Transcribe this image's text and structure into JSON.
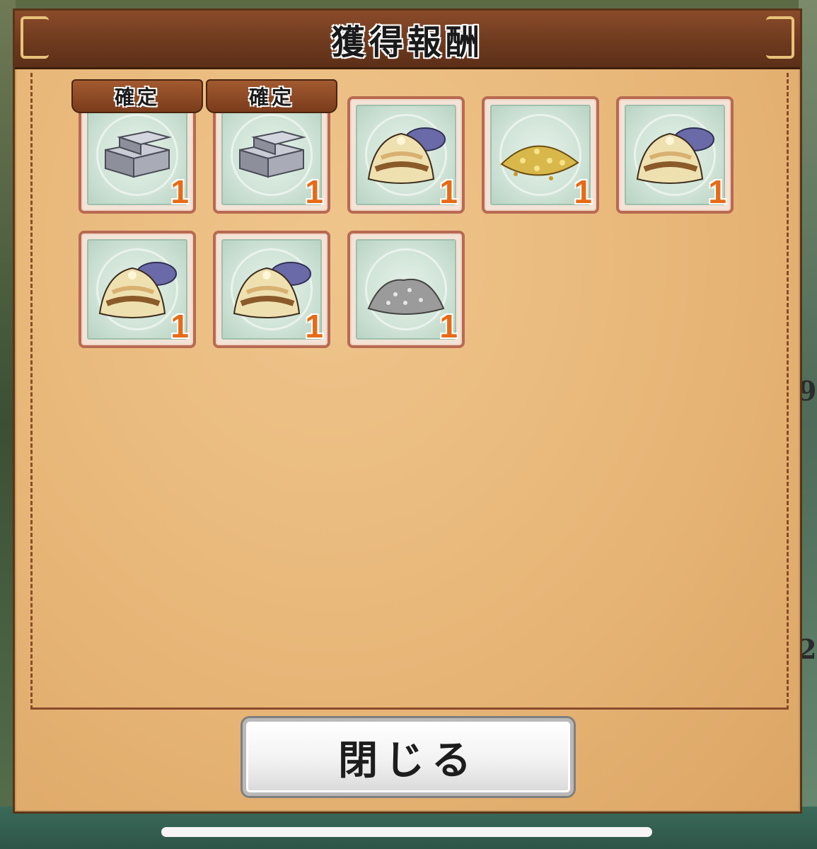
{
  "dialog": {
    "title": "獲得報酬",
    "close_label": "閉じる"
  },
  "rewards": [
    {
      "name": "iron-ingot",
      "quantity": "1",
      "badge": "確定"
    },
    {
      "name": "iron-ingot",
      "quantity": "1",
      "badge": "確定"
    },
    {
      "name": "clam-shell",
      "quantity": "1"
    },
    {
      "name": "gold-grain",
      "quantity": "1"
    },
    {
      "name": "clam-shell",
      "quantity": "1"
    },
    {
      "name": "clam-shell",
      "quantity": "1"
    },
    {
      "name": "clam-shell",
      "quantity": "1"
    },
    {
      "name": "stone-pile",
      "quantity": "1"
    }
  ],
  "background_peek": {
    "right_top": "9",
    "right_bottom": "2"
  },
  "colors": {
    "quantity": "#e86a16",
    "header": "#6e3a1e",
    "panel": "#e9b97a"
  }
}
